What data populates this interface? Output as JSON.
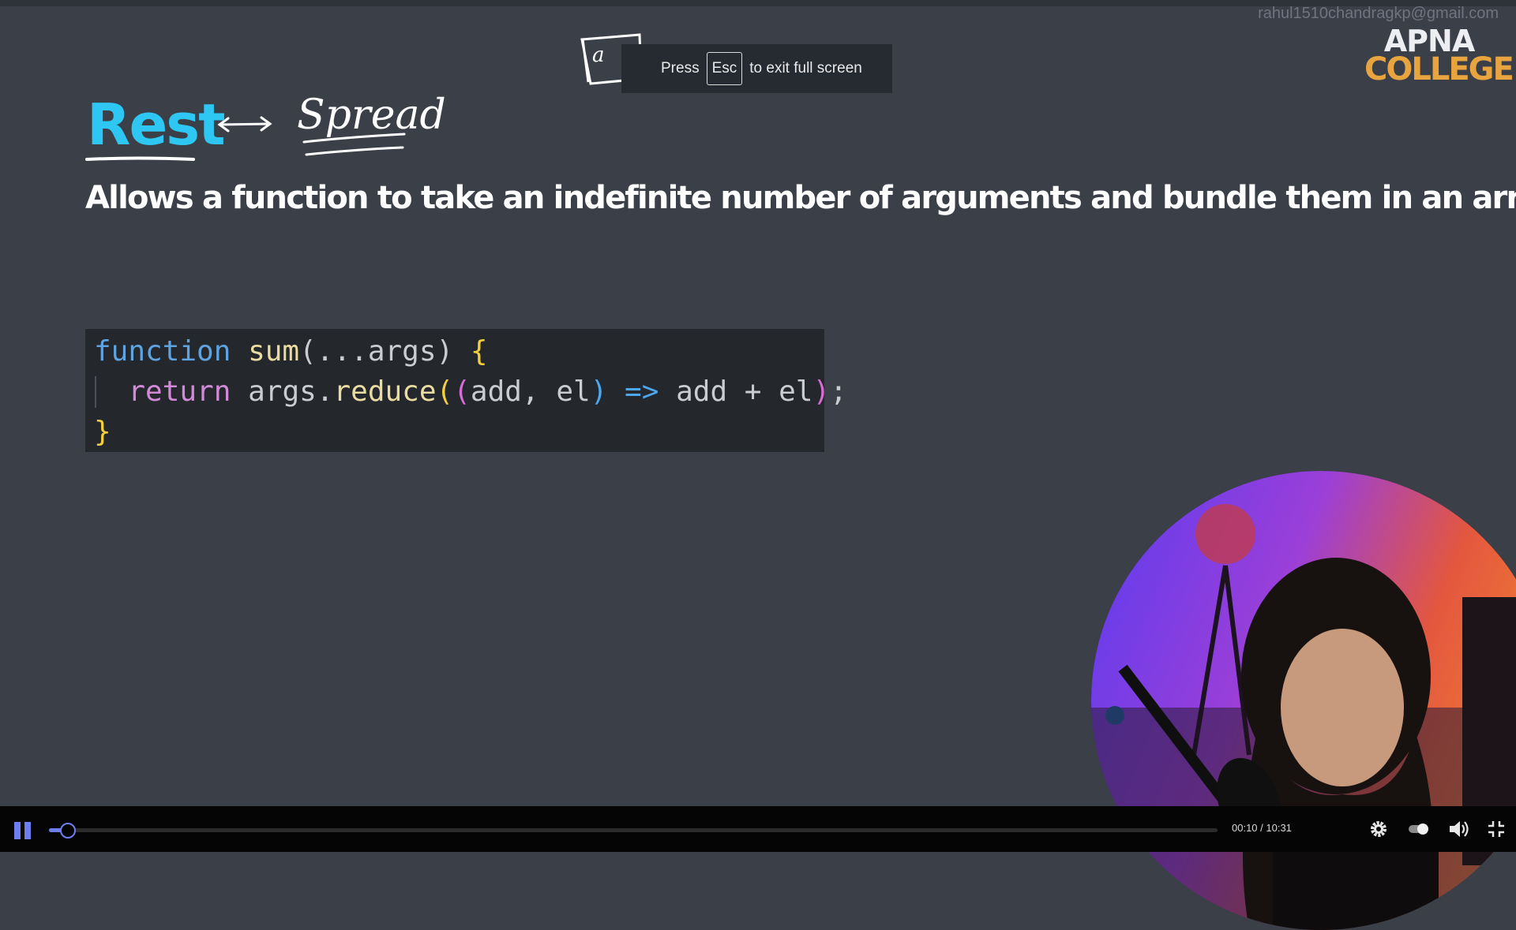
{
  "window": {
    "account_email": "rahul1510chandragkp@gmail.com"
  },
  "brand": {
    "line1": "APNA",
    "line2": "COLLEGE",
    "accent": "#e8a53f"
  },
  "fullscreen_toast": {
    "prefix": "Press",
    "key": "Esc",
    "suffix": "to exit full screen"
  },
  "slide": {
    "title": "Rest",
    "title_color": "#2ec6f2",
    "subtitle": "Allows a function to take an indefinite number of arguments and bundle them in an array",
    "annotations": {
      "handwritten_word": "Spread",
      "handwritten_box_letter": "a"
    },
    "code": {
      "kw_function": "function",
      "fn_sum": "sum",
      "open_paren": "(",
      "rest_args": "...args",
      "close_paren": ")",
      "open_brace": "{",
      "kw_return": "return",
      "args": "args",
      "dot": ".",
      "fn_reduce": "reduce",
      "p1_open": "(",
      "p2_open": "(",
      "param_add": "add",
      "comma": ",",
      "param_el": "el",
      "p2_close": ")",
      "arrow": "=>",
      "expr": "add + el",
      "p1_close": ")",
      "semicolon": ";",
      "close_brace": "}"
    }
  },
  "player": {
    "time": "00:10 / 10:31",
    "progress_fraction": 0.016,
    "icons": [
      "pause-icon",
      "settings-icon",
      "toggle-icon",
      "volume-icon",
      "exit-fullscreen-icon"
    ],
    "accent": "#6d7ff0"
  }
}
